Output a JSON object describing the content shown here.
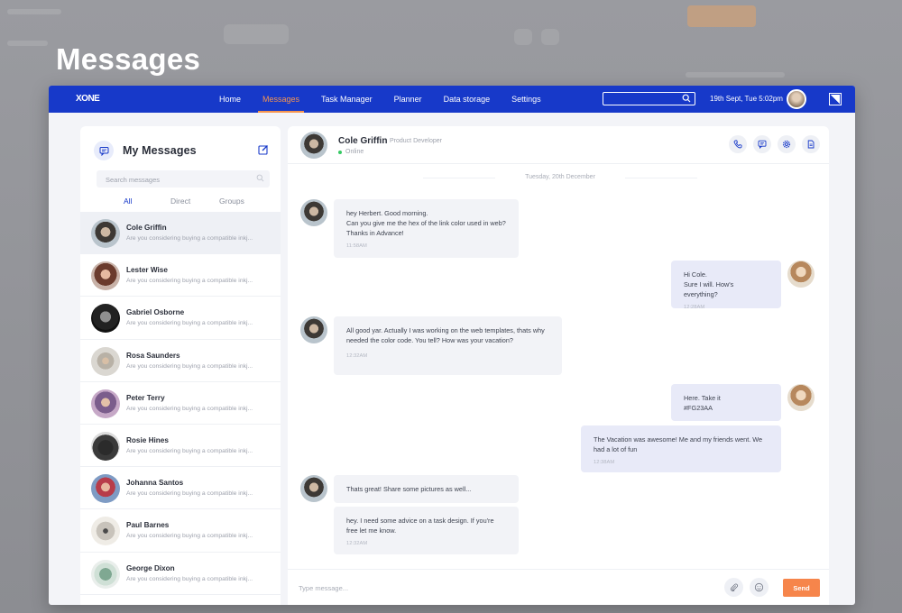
{
  "page_heading": "Messages",
  "app": {
    "logo": "XONE",
    "nav": [
      {
        "label": "Home"
      },
      {
        "label": "Messages"
      },
      {
        "label": "Task Manager"
      },
      {
        "label": "Planner"
      },
      {
        "label": "Data storage"
      },
      {
        "label": "Settings"
      }
    ],
    "active_nav": "Messages",
    "date": "19th Sept, Tue 5:02pm",
    "accent": "#1739c9",
    "highlight": "#f6954f"
  },
  "sidebar": {
    "title": "My Messages",
    "search_placeholder": "Search messages",
    "tabs": [
      {
        "label": "All"
      },
      {
        "label": "Direct"
      },
      {
        "label": "Groups"
      }
    ],
    "active_tab": "All",
    "contacts": [
      {
        "name": "Cole Griffin",
        "preview": "Are you considering buying a compatible inkj..."
      },
      {
        "name": "Lester Wise",
        "preview": "Are you considering buying a compatible inkj..."
      },
      {
        "name": "Gabriel Osborne",
        "preview": "Are you considering buying a compatible inkj..."
      },
      {
        "name": "Rosa Saunders",
        "preview": "Are you considering buying a compatible inkj..."
      },
      {
        "name": "Peter Terry",
        "preview": "Are you considering buying a compatible inkj..."
      },
      {
        "name": "Rosie Hines",
        "preview": "Are you considering buying a compatible inkj..."
      },
      {
        "name": "Johanna Santos",
        "preview": "Are you considering buying a compatible inkj..."
      },
      {
        "name": "Paul Barnes",
        "preview": "Are you considering buying a compatible inkj..."
      },
      {
        "name": "George Dixon",
        "preview": "Are you considering buying a compatible inkj..."
      }
    ]
  },
  "chat": {
    "name": "Cole Griffin",
    "role": "Product Developer",
    "status": "Online",
    "status_color": "#37c964",
    "day": "Tuesday, 20th December",
    "messages": [
      {
        "text": "hey Herbert. Good morning.\nCan you give me the hex of the link color used in web?\nThanks in Advance!",
        "time": "11:58AM"
      },
      {
        "text": "Hi Cole.\nSure I will. How's everything?",
        "time": "12:28AM"
      },
      {
        "text": "All good yar. Actually I was working on the web templates, thats why needed the color code. You tell? How was your vacation?",
        "time": "12:32AM"
      },
      {
        "text": "Here. Take it\n#FG23AA",
        "time": ""
      },
      {
        "text": "The Vacation was awesome! Me and my friends went. We had a lot of fun",
        "time": "12:38AM"
      },
      {
        "text": "Thats great! Share some pictures as well...",
        "time": ""
      },
      {
        "text": "hey. I need some advice on a task design. If you're free let me know.",
        "time": "12:32AM"
      }
    ],
    "composer_placeholder": "Type message...",
    "send_label": "Send",
    "send_color": "#f6854b"
  }
}
